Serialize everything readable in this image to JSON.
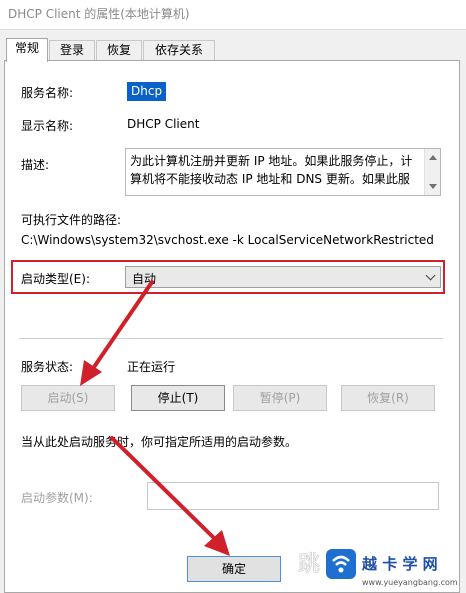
{
  "window": {
    "title": "DHCP Client 的属性(本地计算机)"
  },
  "tabs": [
    {
      "label": "常规",
      "active": true
    },
    {
      "label": "登录",
      "active": false
    },
    {
      "label": "恢复",
      "active": false
    },
    {
      "label": "依存关系",
      "active": false
    }
  ],
  "general": {
    "service_name_label": "服务名称:",
    "service_name_value": "Dhcp",
    "display_name_label": "显示名称:",
    "display_name_value": "DHCP Client",
    "description_label": "描述:",
    "description_value": "为此计算机注册并更新 IP 地址。如果此服务停止，计算机将不能接收动态 IP 地址和 DNS 更新。如果此服",
    "exe_path_label": "可执行文件的路径:",
    "exe_path_value": "C:\\Windows\\system32\\svchost.exe -k LocalServiceNetworkRestricted",
    "startup_type_label": "启动类型(E):",
    "startup_type_value": "自动",
    "service_status_label": "服务状态:",
    "service_status_value": "正在运行",
    "buttons": {
      "start": "启动(S)",
      "stop": "停止(T)",
      "pause": "暂停(P)",
      "resume": "恢复(R)"
    },
    "start_params_hint": "当从此处启动服务时，你可指定所适用的启动参数。",
    "start_params_label": "启动参数(M):",
    "start_params_value": ""
  },
  "footer": {
    "ok_label": "确定"
  },
  "watermark": {
    "brand": "越 卡 学 网",
    "url": "www.yueyangbang.com"
  },
  "colors": {
    "highlight": "#0a62c8",
    "annotation_red": "#d0202a"
  }
}
